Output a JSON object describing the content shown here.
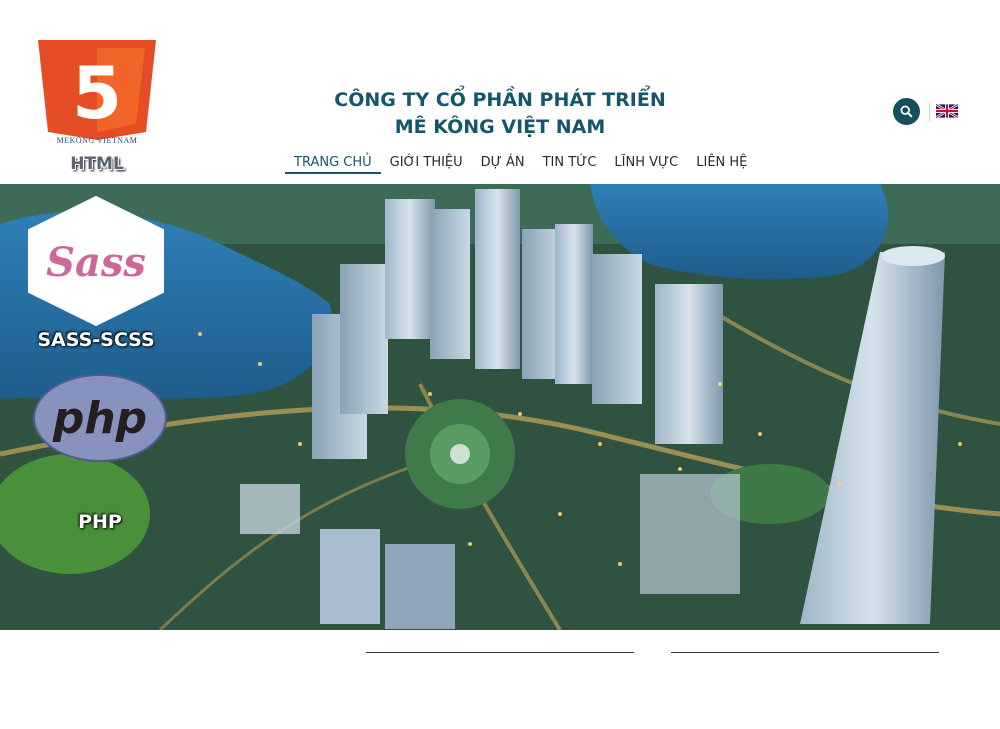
{
  "brand": {
    "html5_mark": "5",
    "mekong_text": "MEKONG VIETNAM",
    "html_label": "HTML"
  },
  "company": {
    "line1": "CÔNG TY CỔ PHẦN PHÁT TRIỂN",
    "line2": "MÊ KÔNG VIỆT NAM"
  },
  "nav": {
    "items": [
      {
        "label": "TRANG CHỦ",
        "active": true
      },
      {
        "label": "GIỚI THIỆU"
      },
      {
        "label": "DỰ ÁN"
      },
      {
        "label": "TIN TỨC"
      },
      {
        "label": "LĨNH VỰC"
      },
      {
        "label": "LIÊN HỆ"
      }
    ]
  },
  "header_actions": {
    "search_icon": "search-icon",
    "language_icon": "uk-flag-icon"
  },
  "badges": {
    "sass_logo_text": "Sass",
    "sass_label": "SASS-SCSS",
    "php_logo_text": "php",
    "php_label": "PHP"
  },
  "colors": {
    "brand_teal": "#14566a",
    "search_bg": "#134f5c",
    "html5_orange": "#e44d26",
    "sass_pink": "#cd6799",
    "php_purple": "#8892bf"
  }
}
